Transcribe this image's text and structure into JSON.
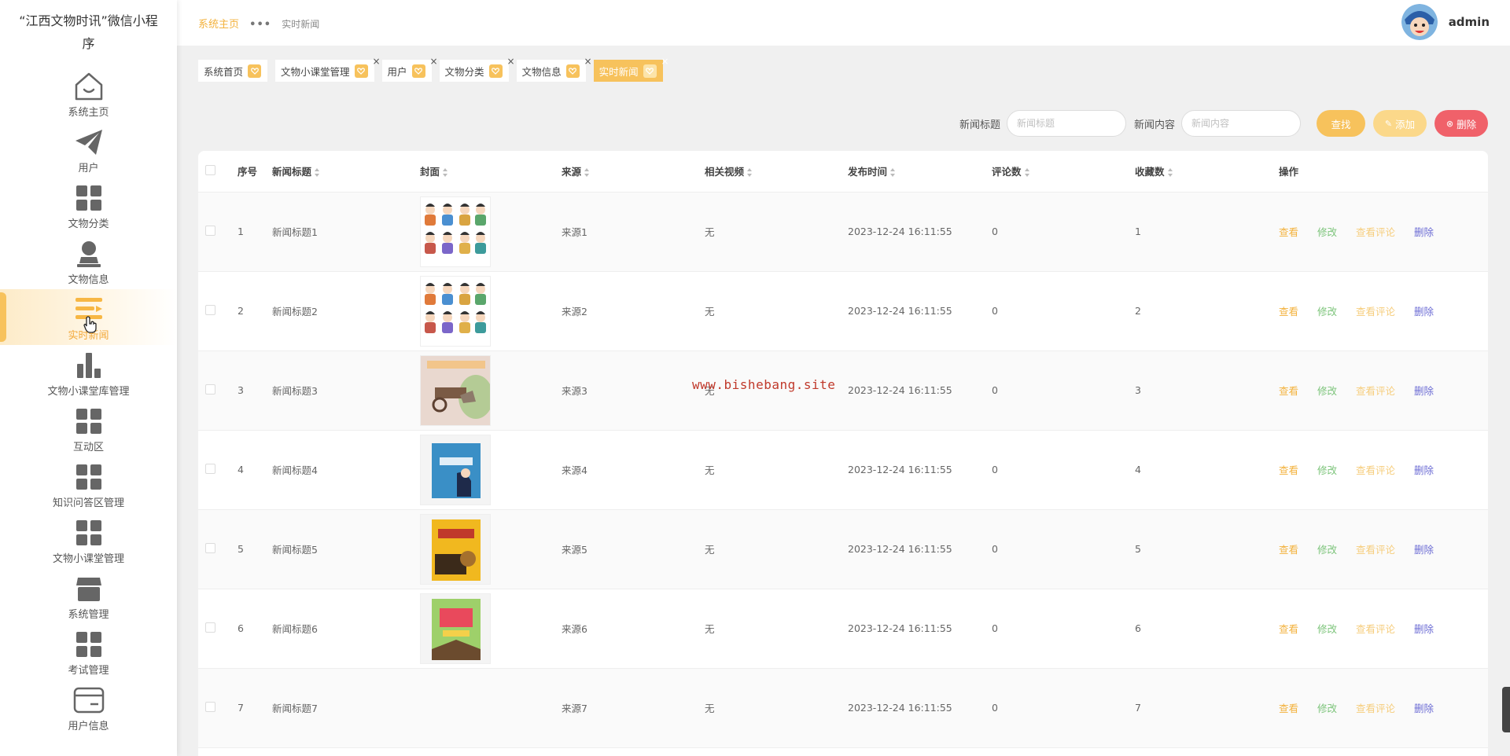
{
  "app": {
    "title": "“江西文物时讯”微信小程序"
  },
  "sidebar": {
    "items": [
      {
        "label": "系统主页",
        "icon": "home-icon"
      },
      {
        "label": "用户",
        "icon": "paper-plane-icon"
      },
      {
        "label": "文物分类",
        "icon": "grid-icon"
      },
      {
        "label": "文物信息",
        "icon": "user-stamp-icon"
      },
      {
        "label": "实时新闻",
        "icon": "list-icon",
        "active": true
      },
      {
        "label": "文物小课堂库管理",
        "icon": "bar-chart-icon"
      },
      {
        "label": "互动区",
        "icon": "grid-icon"
      },
      {
        "label": "知识问答区管理",
        "icon": "grid-icon"
      },
      {
        "label": "文物小课堂管理",
        "icon": "grid-icon"
      },
      {
        "label": "系统管理",
        "icon": "store-icon"
      },
      {
        "label": "考试管理",
        "icon": "grid-icon"
      },
      {
        "label": "用户信息",
        "icon": "card-icon"
      }
    ]
  },
  "header": {
    "breadcrumb_home": "系统主页",
    "breadcrumb_sep": "•••",
    "breadcrumb_current": "实时新闻",
    "username": "admin"
  },
  "tabs": [
    {
      "label": "系统首页",
      "closable": false,
      "active": false
    },
    {
      "label": "文物小课堂管理",
      "closable": true,
      "active": false
    },
    {
      "label": "用户",
      "closable": true,
      "active": false
    },
    {
      "label": "文物分类",
      "closable": true,
      "active": false
    },
    {
      "label": "文物信息",
      "closable": true,
      "active": false
    },
    {
      "label": "实时新闻",
      "closable": true,
      "active": true
    }
  ],
  "search": {
    "title_label": "新闻标题",
    "title_placeholder": "新闻标题",
    "title_value": "",
    "content_label": "新闻内容",
    "content_placeholder": "新闻内容",
    "content_value": "",
    "search_button": "查找",
    "add_button": "添加",
    "delete_button": "删除"
  },
  "table": {
    "columns": [
      "序号",
      "新闻标题",
      "封面",
      "来源",
      "相关视频",
      "发布时间",
      "评论数",
      "收藏数",
      "操作"
    ],
    "sortable": [
      false,
      true,
      true,
      true,
      true,
      true,
      true,
      true,
      false
    ],
    "actions": {
      "view": "查看",
      "edit": "修改",
      "comments": "查看评论",
      "delete": "删除"
    },
    "rows": [
      {
        "index": "1",
        "title": "新闻标题1",
        "cover": "cartoon-people-grid",
        "source": "来源1",
        "video": "无",
        "time": "2023-12-24 16:11:55",
        "comments": "0",
        "favorites": "1"
      },
      {
        "index": "2",
        "title": "新闻标题2",
        "cover": "cartoon-people-grid",
        "source": "来源2",
        "video": "无",
        "time": "2023-12-24 16:11:55",
        "comments": "0",
        "favorites": "2"
      },
      {
        "index": "3",
        "title": "新闻标题3",
        "cover": "book-cart",
        "source": "来源3",
        "video": "无",
        "time": "2023-12-24 16:11:55",
        "comments": "0",
        "favorites": "3"
      },
      {
        "index": "4",
        "title": "新闻标题4",
        "cover": "book-blue",
        "source": "来源4",
        "video": "无",
        "time": "2023-12-24 16:11:55",
        "comments": "0",
        "favorites": "4"
      },
      {
        "index": "5",
        "title": "新闻标题5",
        "cover": "book-yellow",
        "source": "来源5",
        "video": "无",
        "time": "2023-12-24 16:11:55",
        "comments": "0",
        "favorites": "5"
      },
      {
        "index": "6",
        "title": "新闻标题6",
        "cover": "book-green",
        "source": "来源6",
        "video": "无",
        "time": "2023-12-24 16:11:55",
        "comments": "0",
        "favorites": "6"
      },
      {
        "index": "7",
        "title": "新闻标题7",
        "cover": "",
        "source": "来源7",
        "video": "无",
        "time": "2023-12-24 16:11:55",
        "comments": "0",
        "favorites": "7"
      }
    ]
  },
  "watermark": "www.bishebang.site",
  "colors": {
    "accent": "#f7c25c",
    "danger": "#f0616a",
    "edit": "#7cc47a",
    "delete_link": "#6c6cd4"
  }
}
